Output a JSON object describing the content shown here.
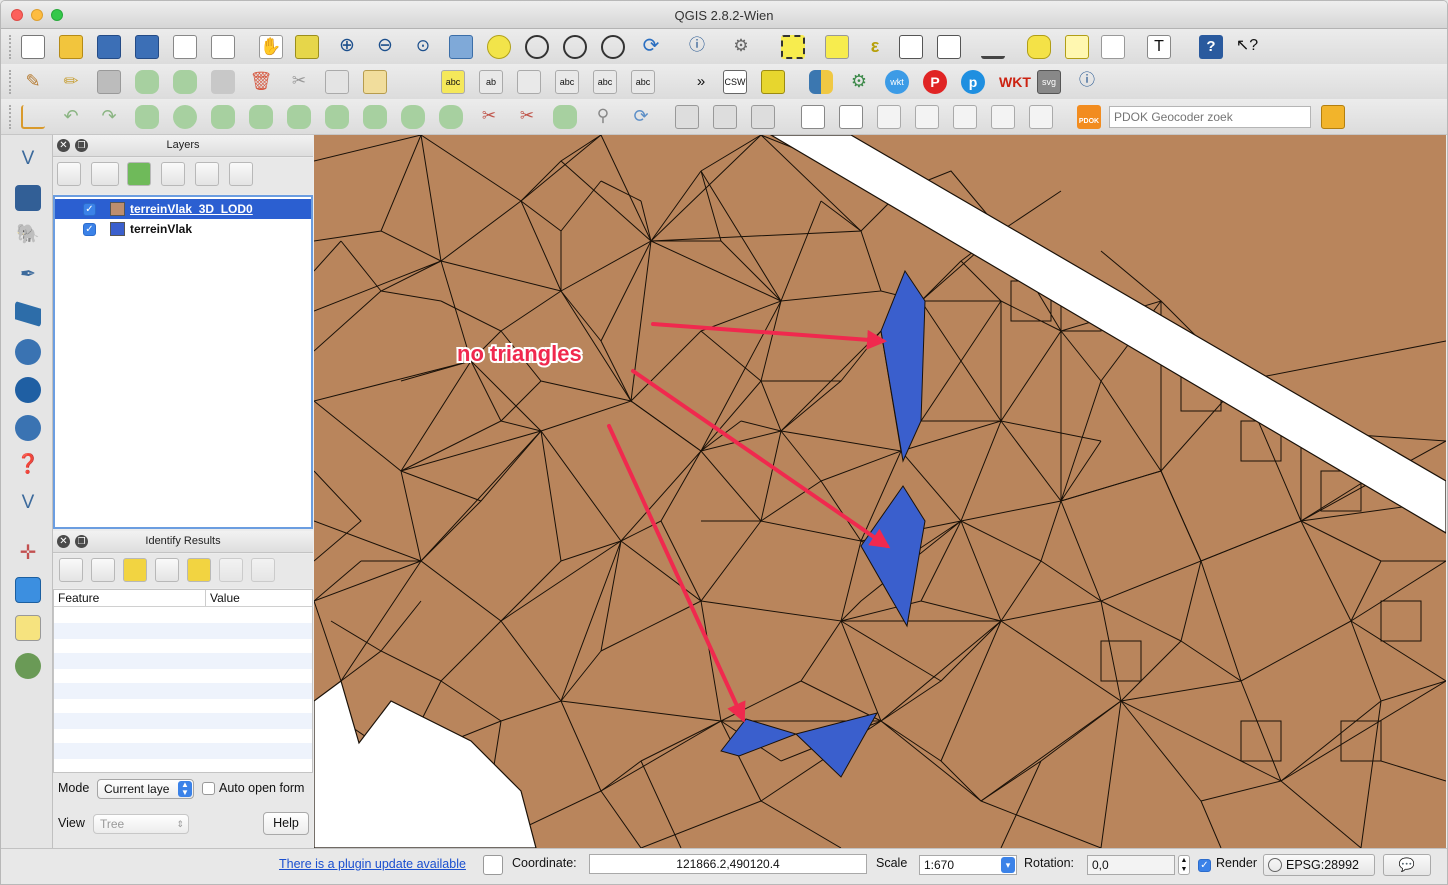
{
  "window": {
    "title": "QGIS 2.8.2-Wien"
  },
  "toolbar_search": {
    "placeholder": "PDOK Geocoder zoek",
    "pdok_badge": "PDOK"
  },
  "toolbar_icons": [
    "new-project-icon",
    "open-project-icon",
    "save-project-icon",
    "save-as-icon",
    "new-print-composer-icon",
    "composer-manager-icon",
    "pan-icon",
    "pan-to-selection-icon",
    "zoom-in-icon",
    "zoom-out-icon",
    "zoom-native-icon",
    "zoom-full-icon",
    "zoom-to-selection-icon",
    "zoom-to-layer-icon",
    "zoom-last-icon",
    "zoom-next-icon",
    "refresh-icon",
    "identify-icon",
    "action-icon",
    "select-icon",
    "deselect-icon",
    "expression-select-icon",
    "attribute-table-icon",
    "field-calculator-icon",
    "measure-icon",
    "map-tips-icon",
    "annotation-icon",
    "text-annotation-icon",
    "text-tool-icon",
    "help-icon",
    "whats-this-icon"
  ],
  "layers_panel": {
    "title": "Layers",
    "layers": [
      {
        "name": "terreinVlak_3D_LOD0",
        "checked": true,
        "selected": true,
        "color": "#bd8e6e"
      },
      {
        "name": "terreinVlak",
        "checked": true,
        "selected": false,
        "color": "#3a5fcd"
      }
    ]
  },
  "identify_panel": {
    "title": "Identify Results",
    "col_feature": "Feature",
    "col_value": "Value",
    "mode_label": "Mode",
    "mode_value": "Current laye",
    "auto_open_label": "Auto open form",
    "view_label": "View",
    "view_value": "Tree",
    "help_label": "Help"
  },
  "map": {
    "annotation": "no triangles",
    "fill_color": "#b9855c",
    "hole_color": "#3a5fcd",
    "arrow_color": "#f0294e"
  },
  "statusbar": {
    "plugin_update_link": "There is a plugin update available",
    "coordinate_label": "Coordinate:",
    "coordinate_value": "121866.2,490120.4",
    "scale_label": "Scale",
    "scale_value": "1:670",
    "rotation_label": "Rotation:",
    "rotation_value": "0,0",
    "render_label": "Render",
    "crs_label": "EPSG:28992"
  }
}
